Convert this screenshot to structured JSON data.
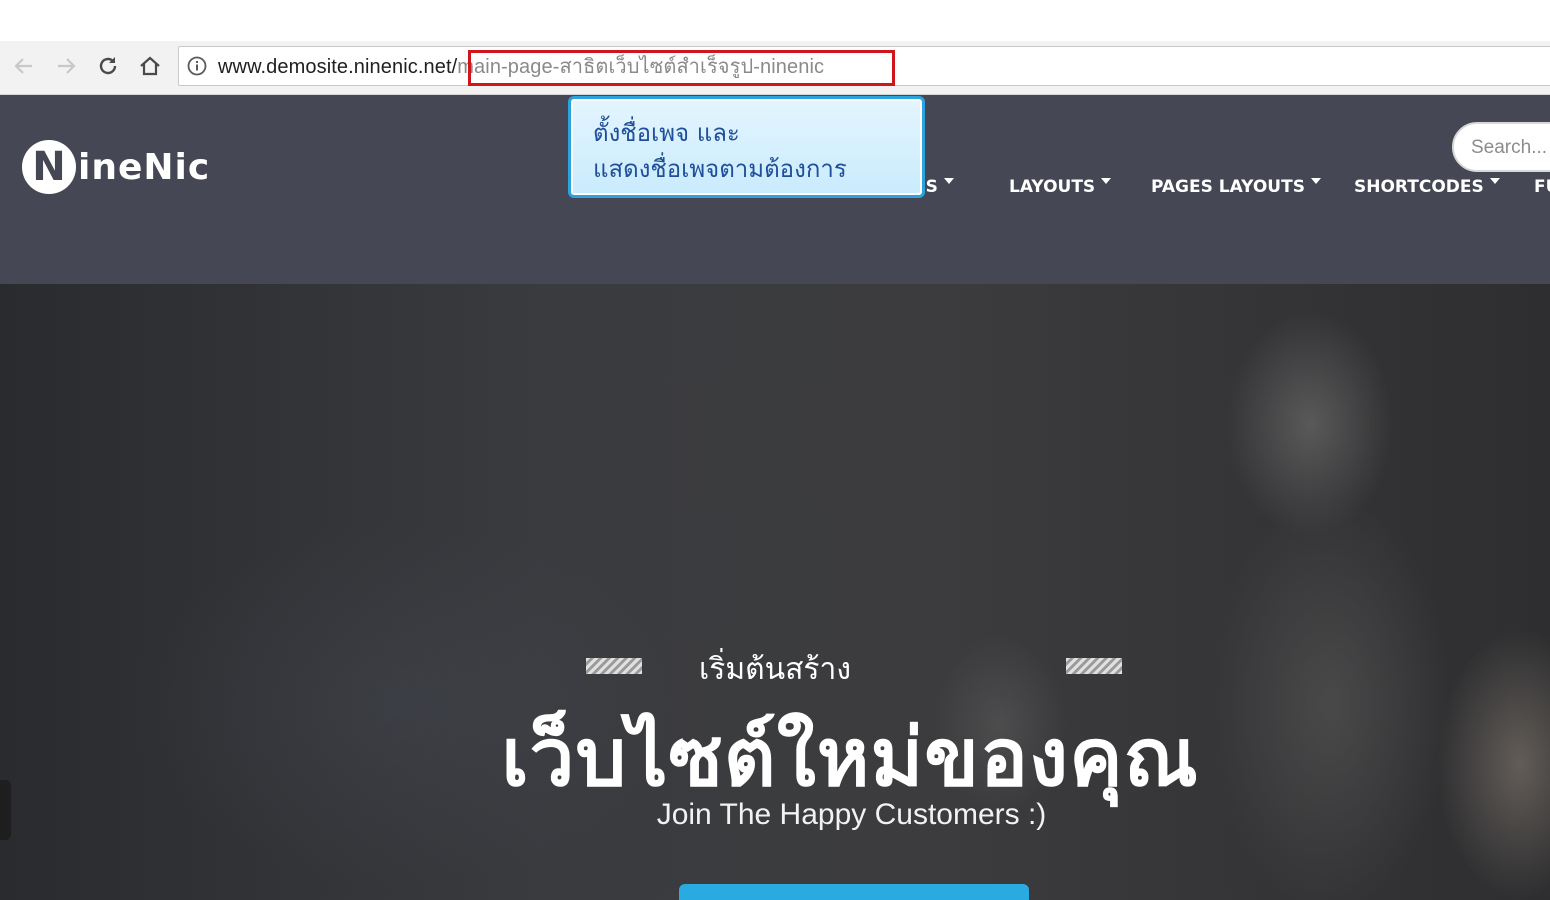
{
  "browser": {
    "url_host": "www.demosite.ninenic.net/",
    "url_path": "main-page-สาธิตเว็บไซต์สำเร็จรูป-ninenic",
    "buttons": {
      "back": "back-arrow-icon",
      "forward": "forward-arrow-icon",
      "reload": "reload-icon",
      "home": "home-icon",
      "info": "info-icon"
    }
  },
  "callout": {
    "line1": "ตั้งชื่อเพจ และ",
    "line2": "แสดงชื่อเพจตามต้องการ"
  },
  "header": {
    "logo_n": "N",
    "logo_text": "ineNic",
    "menu": [
      {
        "label": "ES"
      },
      {
        "label": "LAYOUTS"
      },
      {
        "label": "PAGES LAYOUTS"
      },
      {
        "label": "SHORTCODES"
      },
      {
        "label": "FU"
      }
    ],
    "search_placeholder": "Search..."
  },
  "hero": {
    "subtitle": "เริ่มต้นสร้าง",
    "title": "เว็บไซต์ใหม่ของคุณ",
    "tagline": "Join The Happy Customers :)"
  },
  "colors": {
    "header_bg": "#454854",
    "url_highlight": "#d0151b",
    "callout_border": "#2aa3df",
    "callout_text": "#1f4f9a",
    "cta": "#29abe2"
  }
}
